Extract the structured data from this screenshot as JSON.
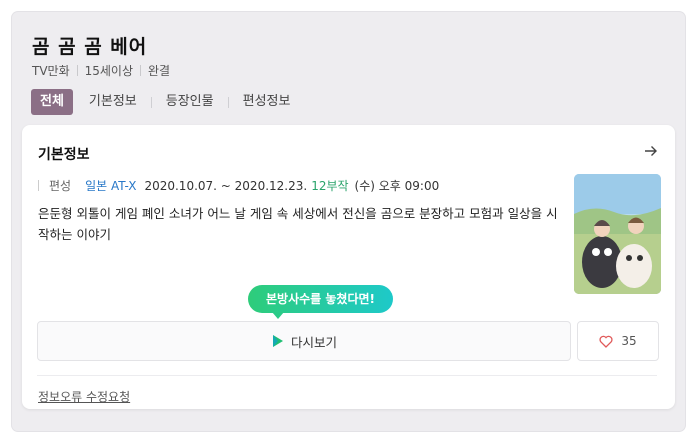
{
  "header": {
    "title": "곰 곰 곰 베어",
    "meta": [
      "TV만화",
      "15세이상",
      "완결"
    ]
  },
  "tabs": [
    {
      "label": "전체",
      "active": true
    },
    {
      "label": "기본정보"
    },
    {
      "label": "등장인물"
    },
    {
      "label": "편성정보"
    }
  ],
  "card": {
    "title": "기본정보",
    "airing": {
      "label": "편성",
      "channel": "일본 AT-X",
      "period": "2020.10.07. ~ 2020.12.23.",
      "episodes": "12부작",
      "time": "(수) 오후 09:00"
    },
    "description": "은둔형 외톨이 게임 폐인 소녀가 어느 날 게임 속 세상에서 전신을 곰으로 분장하고 모험과 일상을 시작하는 이야기",
    "tooltip": "본방사수를 놓쳤다면!",
    "rewatch_label": "다시보기",
    "likes": "35",
    "report_link": "정보오류 수정요청"
  },
  "colors": {
    "tab_active_bg": "#8b6f86",
    "channel": "#2878c8",
    "episodes": "#2aa36b",
    "tooltip_start": "#2ecc7a",
    "tooltip_end": "#1ec9c9"
  },
  "icons": {
    "arrow": "arrow-right-icon",
    "play": "play-icon",
    "heart": "heart-outline-icon"
  }
}
